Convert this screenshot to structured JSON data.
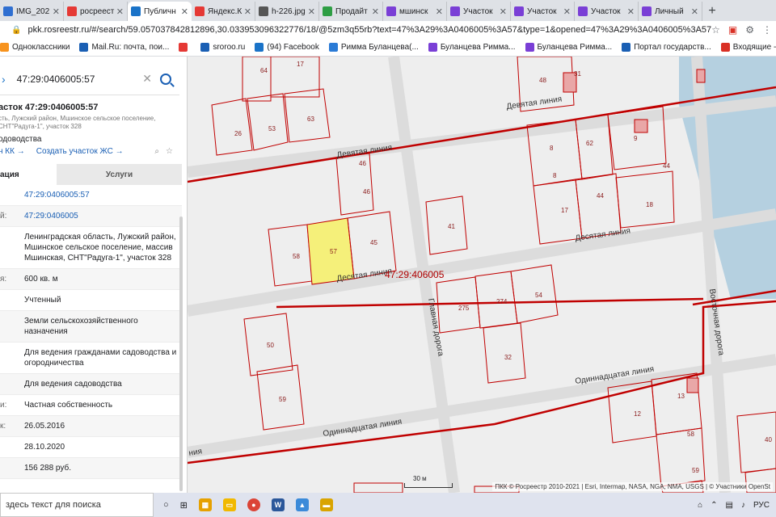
{
  "browser": {
    "tabs": [
      {
        "title": "IMG_202",
        "icon_color": "#2f6fd1",
        "icon": "image-icon",
        "active": false
      },
      {
        "title": "росреест",
        "icon_color": "#e53935",
        "icon": "yandex-icon",
        "active": false
      },
      {
        "title": "Публичн",
        "icon_color": "#1a73c8",
        "icon": "rosreestr-icon",
        "active": true
      },
      {
        "title": "Яндекс.К",
        "icon_color": "#e53935",
        "icon": "map-pin-icon",
        "active": false
      },
      {
        "title": "h-226.jpg",
        "icon_color": "#555555",
        "icon": "globe-icon",
        "active": false
      },
      {
        "title": "Продайт",
        "icon_color": "#2e9e44",
        "icon": "avito-icon",
        "active": false
      },
      {
        "title": "мшинск",
        "icon_color": "#7a3fd6",
        "icon": "dots-icon",
        "active": false
      },
      {
        "title": "Участок",
        "icon_color": "#7a3fd6",
        "icon": "dots-icon",
        "active": false
      },
      {
        "title": "Участок",
        "icon_color": "#7a3fd6",
        "icon": "dots-icon",
        "active": false
      },
      {
        "title": "Участок",
        "icon_color": "#7a3fd6",
        "icon": "dots-icon",
        "active": false
      },
      {
        "title": "Личный",
        "icon_color": "#7a3fd6",
        "icon": "dots-icon",
        "active": false
      }
    ],
    "url": "pkk.rosreestr.ru/#/search/59.057037842812896,30.033953096322776/18/@5zm3q55rb?text=47%3A29%3A0406005%3A57&type=1&opened=47%3A29%3A0406005%3A57",
    "bookmarks": [
      {
        "label": "Одноклассники",
        "color": "#f7931e"
      },
      {
        "label": "Mail.Ru: почта, пои...",
        "color": "#1a5fb4"
      },
      {
        "label": "",
        "color": "#e53935"
      },
      {
        "label": "sroroo.ru",
        "color": "#1a5fb4"
      },
      {
        "label": "(94) Facebook",
        "color": "#1a73c8"
      },
      {
        "label": "Римма Буланцева(...",
        "color": "#2b7bd6"
      },
      {
        "label": "Буланцева Римма...",
        "color": "#7a3fd6"
      },
      {
        "label": "Буланцева Римма...",
        "color": "#7a3fd6"
      },
      {
        "label": "Портал государств...",
        "color": "#1a5fb4"
      },
      {
        "label": "Входящие - allliven...",
        "color": "#d93025"
      }
    ]
  },
  "panel": {
    "search_value": "47:29:0406005:57",
    "object_title": "астoк 47:29:0406005:57",
    "object_subtitle": "сть, Лужский район, Мшинское сельское поселение, СНТ\"Радуга-1\", участок 328",
    "object_kind": "одоводства",
    "link_kk": "н КК →",
    "link_create": "Создать участок ЖС →",
    "tab_info": "ация",
    "tab_services": "Услуги",
    "rows": [
      {
        "key": "",
        "value": "47:29:0406005:57",
        "link": true
      },
      {
        "key": "й:",
        "value": "47:29:0406005",
        "link": true
      },
      {
        "key": "",
        "value": "Ленинградская область, Лужский район, Мшинское сельское поселение, массив Мшинская, СНТ\"Радуга-1\", участок 328",
        "link": false
      },
      {
        "key": "я:",
        "value": "600 кв. м",
        "link": false
      },
      {
        "key": "",
        "value": "Учтенный",
        "link": false
      },
      {
        "key": "",
        "value": "Земли сельскохозяйственного назначения",
        "link": false
      },
      {
        "key": "",
        "value": "Для ведения гражданами садоводства и огородничества",
        "link": false
      },
      {
        "key": "",
        "value": "Для ведения садоводства",
        "link": false
      },
      {
        "key": "и:",
        "value": "Частная собственность",
        "link": false
      },
      {
        "key": "к:",
        "value": "26.05.2016",
        "link": false
      },
      {
        "key": "",
        "value": "28.10.2020",
        "link": false
      },
      {
        "key": "",
        "value": "156 288 руб.",
        "link": false
      }
    ]
  },
  "map": {
    "plots": [
      "64",
      "17",
      "48",
      "31",
      "26",
      "53",
      "63",
      "8",
      "62",
      "9",
      "44",
      "46",
      "46",
      "8",
      "17",
      "44",
      "18",
      "41",
      "58",
      "57",
      "45",
      "275",
      "274",
      "54",
      "32",
      "50",
      "59",
      "13",
      "12",
      "58",
      "40",
      "59"
    ],
    "roads": [
      "Девятая линия",
      "Девятая линия",
      "Десятая линия",
      "Десятая линия",
      "Главная дорога",
      "Восточная дорога",
      "Одиннадцатая линия",
      "Одиннадцатая линия",
      "ния"
    ],
    "quarter": "47:29:406005",
    "scale": "30 м",
    "copyright": "ПКК © Росреестр 2010-2021 | Esri, Intermap, NASA, NGA, NMA, USGS | © Участники OpenSt"
  },
  "taskbar": {
    "search_placeholder": "здесь текст для поиска",
    "lang": "РУС"
  }
}
